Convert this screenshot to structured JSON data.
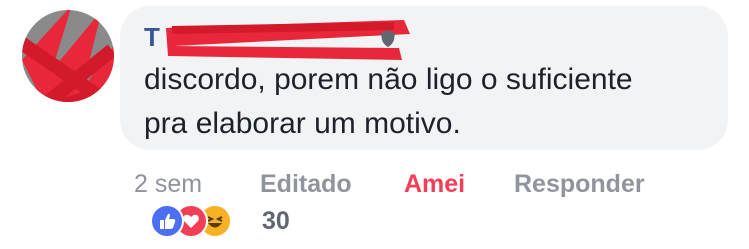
{
  "comment": {
    "author_initial": "T",
    "text": "discordo, porem não ligo o suficiente\npra elaborar um motivo."
  },
  "actions": {
    "time": "2 sem",
    "edited_label": "Editado",
    "reaction_label": "Amei",
    "reply_label": "Responder"
  },
  "reactions": {
    "types": [
      "like-icon",
      "love-icon",
      "haha-icon"
    ],
    "count": "30"
  },
  "colors": {
    "bubble_bg": "#f2f3f5",
    "text": "#1d2129",
    "meta": "#90949c",
    "love": "#f33e58",
    "like": "#4c6ef5",
    "haha": "#f7b125",
    "redaction": "#e8283a"
  }
}
